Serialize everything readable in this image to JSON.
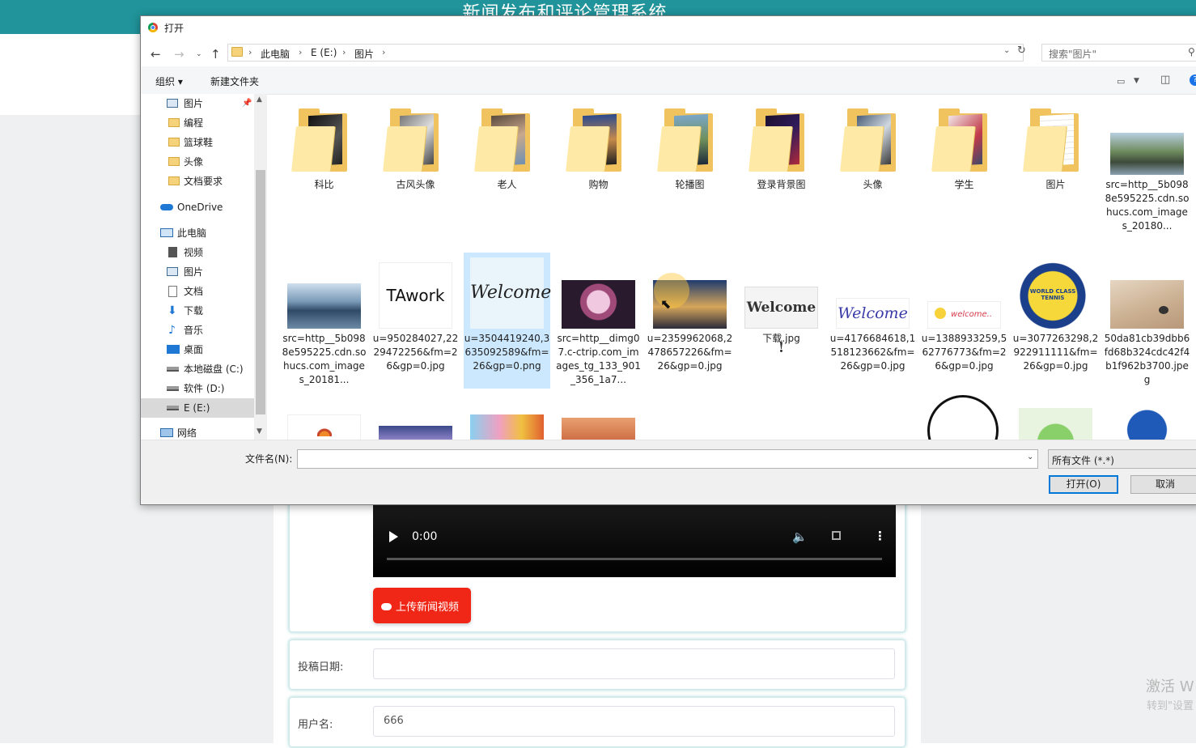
{
  "background_page": {
    "header_title": "新闻发布和评论管理系统",
    "video": {
      "time": "0:00"
    },
    "upload_button": "上传新闻视频",
    "submit_date_label": "投稿日期:",
    "submit_date_value": "",
    "username_label": "用户名:",
    "username_value": "666",
    "watermark_line1": "激活 W",
    "watermark_line2": "转到\"设置"
  },
  "dialog": {
    "title": "打开",
    "breadcrumbs": [
      "此电脑",
      "E (E:)",
      "图片"
    ],
    "search_placeholder": "搜索\"图片\"",
    "toolbar": {
      "organize": "组织 ▾",
      "new_folder": "新建文件夹"
    },
    "nav_pane": [
      {
        "label": "图片",
        "icon": "pictures-icon"
      },
      {
        "label": "编程",
        "icon": "folder-icon"
      },
      {
        "label": "篮球鞋",
        "icon": "folder-icon"
      },
      {
        "label": "头像",
        "icon": "folder-icon"
      },
      {
        "label": "文档要求",
        "icon": "folder-icon"
      },
      {
        "label": "OneDrive",
        "icon": "cloud-icon"
      },
      {
        "label": "此电脑",
        "icon": "computer-icon"
      },
      {
        "label": "视频",
        "icon": "video-icon"
      },
      {
        "label": "图片",
        "icon": "pictures-icon"
      },
      {
        "label": "文档",
        "icon": "document-icon"
      },
      {
        "label": "下载",
        "icon": "download-icon"
      },
      {
        "label": "音乐",
        "icon": "music-icon"
      },
      {
        "label": "桌面",
        "icon": "desktop-icon"
      },
      {
        "label": "本地磁盘 (C:)",
        "icon": "drive-icon"
      },
      {
        "label": "软件 (D:)",
        "icon": "drive-icon"
      },
      {
        "label": "E (E:)",
        "icon": "drive-icon"
      },
      {
        "label": "网络",
        "icon": "network-icon"
      }
    ],
    "row1": [
      {
        "name": "科比",
        "kind": "folder"
      },
      {
        "name": "古风头像",
        "kind": "folder"
      },
      {
        "name": "老人",
        "kind": "folder"
      },
      {
        "name": "购物",
        "kind": "folder"
      },
      {
        "name": "轮播图",
        "kind": "folder"
      },
      {
        "name": "登录背景图",
        "kind": "folder"
      },
      {
        "name": "头像",
        "kind": "folder"
      },
      {
        "name": "学生",
        "kind": "folder"
      },
      {
        "name": "图片",
        "kind": "folder"
      },
      {
        "name": "src=http__5b0988e595225.cdn.sohucs.com_images_20180...",
        "kind": "image"
      }
    ],
    "row2": [
      {
        "name": "src=http__5b0988e595225.cdn.sohucs.com_images_20181...",
        "kind": "image"
      },
      {
        "name": "u=950284027,2229472256&fm=26&gp=0.jpg",
        "kind": "image",
        "thumb_text": "TAwork"
      },
      {
        "name": "u=3504419240,3635092589&fm=26&gp=0.png",
        "kind": "image",
        "thumb_text": "Welcome"
      },
      {
        "name": "src=http__dimg07.c-ctrip.com_images_tg_133_901_356_1a7...",
        "kind": "image"
      },
      {
        "name": "u=2359962068,2478657226&fm=26&gp=0.jpg",
        "kind": "image"
      },
      {
        "name": "下载.jpg",
        "kind": "image",
        "thumb_text": "Welcome !"
      },
      {
        "name": "u=4176684618,1518123662&fm=26&gp=0.jpg",
        "kind": "image",
        "thumb_text": "Welcome"
      },
      {
        "name": "u=1388933259,562776773&fm=26&gp=0.jpg",
        "kind": "image",
        "thumb_text": "welcome.."
      },
      {
        "name": "u=3077263298,2922911111&fm=26&gp=0.jpg",
        "kind": "image",
        "thumb_text": "WORLD CLASS TENNIS"
      },
      {
        "name": "50da81cb39dbb6fd68b324cdc42f4b1f962b3700.jpeg",
        "kind": "image"
      }
    ],
    "file_name_label": "文件名(N):",
    "file_name_value": "",
    "file_type": "所有文件 (*.*)",
    "open_button": "打开(O)",
    "cancel_button": "取消"
  },
  "colors": {
    "header": "#20949a",
    "upload_button": "#f02616",
    "selection": "#cce8ff",
    "primary_border": "#0078d7"
  }
}
